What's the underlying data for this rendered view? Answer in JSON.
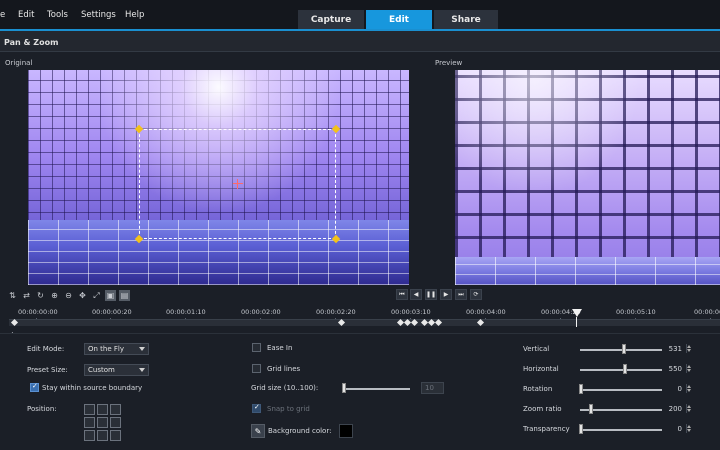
{
  "menu": {
    "items": [
      "e",
      "Edit",
      "Tools",
      "Settings",
      "Help"
    ]
  },
  "tabs": [
    {
      "label": "Capture"
    },
    {
      "label": "Edit"
    },
    {
      "label": "Share"
    }
  ],
  "title": "Pan & Zoom",
  "panels": {
    "original": "Original",
    "preview": "Preview"
  },
  "timeline": {
    "labels": [
      "00:00:00:00",
      "00:00:00:20",
      "00:00:01:10",
      "00:00:02:00",
      "00:00:02:20",
      "00:00:03:10",
      "00:00:04:00",
      "00:00:04:20",
      "00:00:05:10",
      "00:00:06"
    ]
  },
  "props": {
    "edit_mode_label": "Edit Mode:",
    "edit_mode_value": "On the Fly",
    "preset_size_label": "Preset Size:",
    "preset_size_value": "Custom",
    "stay_within": "Stay within source boundary",
    "position_label": "Position:",
    "ease_in": "Ease In",
    "grid_lines": "Grid lines",
    "grid_size_label": "Grid size (10..100):",
    "grid_size_value": "10",
    "snap_to_grid": "Snap to grid",
    "bg_color_label": "Background color:",
    "background_color": "#000000",
    "vertical_label": "Vertical",
    "vertical_value": "531",
    "horizontal_label": "Horizontal",
    "horizontal_value": "550",
    "rotation_label": "Rotation",
    "rotation_value": "0",
    "zoom_label": "Zoom ratio",
    "zoom_value": "200",
    "transparency_label": "Transparency",
    "transparency_value": "0"
  },
  "colors": {
    "accent": "#1797dd",
    "bg": "#1b1f27",
    "handle": "#f3c21a"
  }
}
